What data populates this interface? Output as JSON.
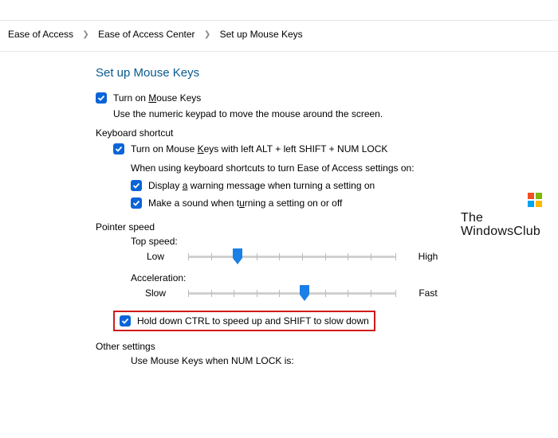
{
  "breadcrumb": {
    "a": "Ease of Access",
    "b": "Ease of Access Center",
    "c": "Set up Mouse Keys"
  },
  "title": "Set up Mouse Keys",
  "turnOn": {
    "pre": "Turn on ",
    "u": "M",
    "post": "ouse Keys"
  },
  "turnOnDesc": "Use the numeric keypad to move the mouse around the screen.",
  "kbShortcut": {
    "label": "Keyboard shortcut",
    "turnOn": {
      "pre": "Turn on Mouse ",
      "u": "K",
      "post": "eys with left ALT + left SHIFT + NUM LOCK"
    },
    "whenUsing": "When using keyboard shortcuts to turn Ease of Access settings on:",
    "displayWarn": {
      "pre": "Display ",
      "u": "a",
      "post": " warning message when turning a setting on"
    },
    "makeSound": {
      "pre": "Make a sound when t",
      "u": "u",
      "post": "rning a setting on or off"
    }
  },
  "pointer": {
    "label": "Pointer speed",
    "topSpeed": "Top speed:",
    "low": "Low",
    "high": "High",
    "accel": "Acceleration:",
    "slow": "Slow",
    "fast": "Fast",
    "holdCtrl": "Hold down CTRL to speed up and SHIFT to slow down"
  },
  "other": {
    "label": "Other settings",
    "useWhen": "Use Mouse Keys when NUM LOCK is:"
  },
  "watermark": {
    "top": "The",
    "bot": "WindowsClub"
  }
}
